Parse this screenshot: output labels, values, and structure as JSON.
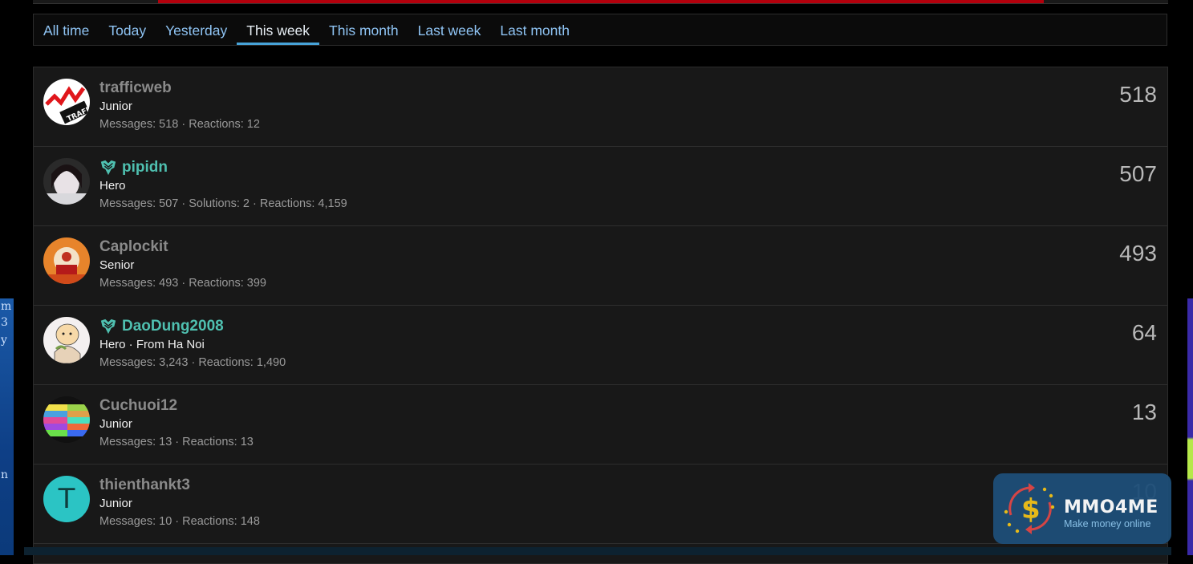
{
  "tabs": [
    {
      "label": "All time"
    },
    {
      "label": "Today"
    },
    {
      "label": "Yesterday"
    },
    {
      "label": "This week",
      "active": true
    },
    {
      "label": "This month"
    },
    {
      "label": "Last week"
    },
    {
      "label": "Last month"
    }
  ],
  "members": [
    {
      "name": "trafficweb",
      "title": "Junior",
      "stats": "Messages: 518 · Reactions: 12",
      "count": "518",
      "hero": false
    },
    {
      "name": "pipidn",
      "title": "Hero",
      "stats": "Messages: 507 · Solutions: 2 · Reactions: 4,159",
      "count": "507",
      "hero": true
    },
    {
      "name": "Caplockit",
      "title": "Senior",
      "stats": "Messages: 493 · Reactions: 399",
      "count": "493",
      "hero": false
    },
    {
      "name": "DaoDung2008",
      "title": "Hero · From Ha Noi",
      "stats": "Messages: 3,243 · Reactions: 1,490",
      "count": "64",
      "hero": true
    },
    {
      "name": "Cuchuoi12",
      "title": "Junior",
      "stats": "Messages: 13 · Reactions: 13",
      "count": "13",
      "hero": false
    },
    {
      "name": "thienthankt3",
      "title": "Junior",
      "stats": "Messages: 10 · Reactions: 148",
      "count": "10",
      "hero": false,
      "avatar_letter": "T"
    }
  ],
  "logo": {
    "brand": "MMO4ME",
    "tagline": "Make money online"
  },
  "colors": {
    "accent": "#47a3d8",
    "hero": "#4fc0b0",
    "progress": "#b3000c"
  }
}
